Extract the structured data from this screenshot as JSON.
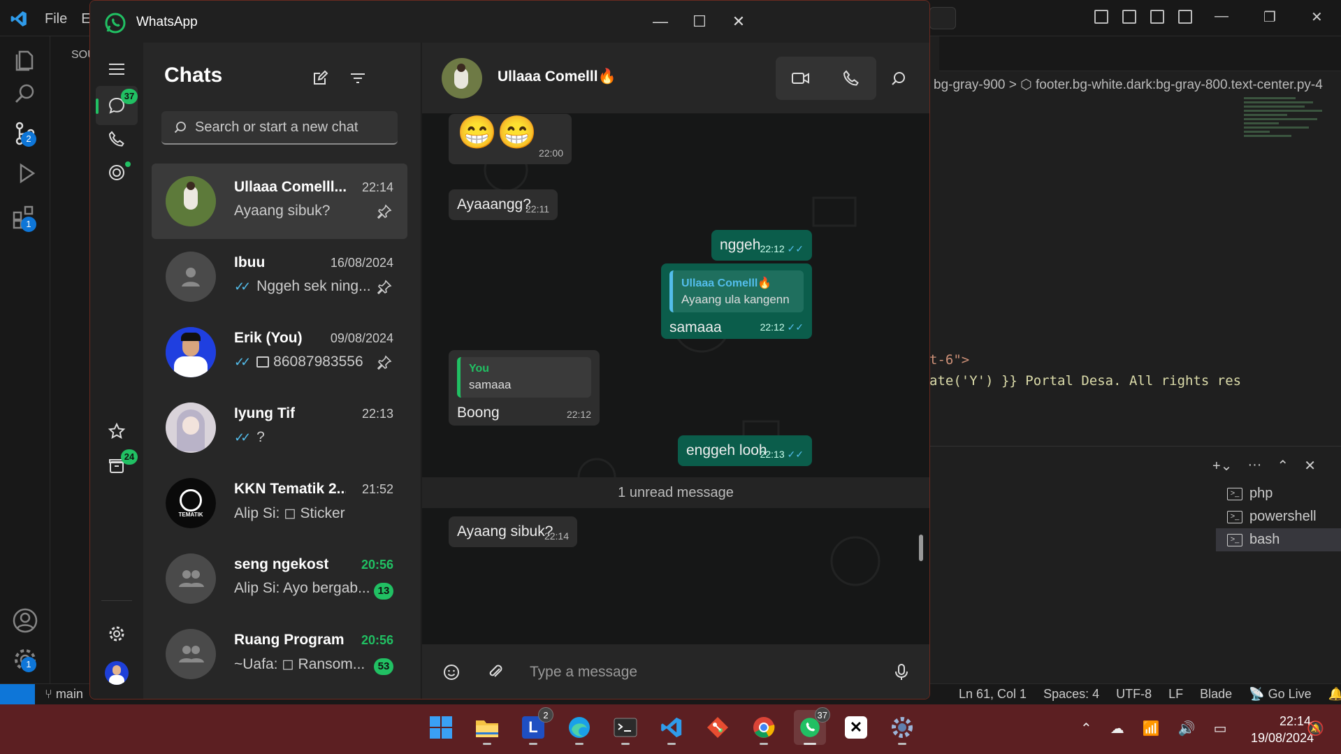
{
  "vscode": {
    "menu": [
      "File",
      "E"
    ],
    "explorer_header": "SOU",
    "breadcrumb": "bg-gray-900 > ⬡ footer.bg-white.dark:bg-gray-800.text-center.py-4",
    "code_line_1": "t-6\">",
    "code_line_2": "ate('Y') }} Portal Desa. All rights res",
    "terminals": [
      "php",
      "powershell",
      "bash"
    ],
    "active_terminal": "bash",
    "activity_badges": {
      "source_control": "2",
      "extensions": "1",
      "settings": "1"
    },
    "status": {
      "branch": "main",
      "position": "Ln 61, Col 1",
      "spaces": "Spaces: 4",
      "encoding": "UTF-8",
      "eol": "LF",
      "language": "Blade",
      "golive": "Go Live"
    }
  },
  "whatsapp": {
    "window_title": "WhatsApp",
    "nav": {
      "chats_badge": "37",
      "archive_badge": "24"
    },
    "chatlist": {
      "title": "Chats",
      "search_placeholder": "Search or start a new chat",
      "items": [
        {
          "name": "Ullaaa Comelll...",
          "time": "22:14",
          "preview": "Ayaang sibuk?",
          "pinned": true,
          "active": true,
          "ticks": false,
          "avatar": "photo-green"
        },
        {
          "name": "Ibuu",
          "time": "16/08/2024",
          "preview": "Nggeh sek ning...",
          "pinned": true,
          "ticks": true,
          "avatar": "default"
        },
        {
          "name": "Erik (You)",
          "time": "09/08/2024",
          "preview": "86087983556",
          "pinned": true,
          "ticks": true,
          "photo": true,
          "avatar": "photo-blue"
        },
        {
          "name": "Iyung Tif",
          "time": "22:13",
          "preview": "?",
          "ticks": true,
          "avatar": "photo-anime"
        },
        {
          "name": "KKN Tematik 2...",
          "time": "21:52",
          "preview": "Alip Si: ◻ Sticker",
          "avatar": "kkn-logo"
        },
        {
          "name": "seng ngekost",
          "time": "20:56",
          "preview": "Alip Si: Ayo bergab...",
          "unread": "13",
          "time_green": true,
          "avatar": "group"
        },
        {
          "name": "Ruang Program",
          "time": "20:56",
          "preview": "~Uafa: ◻ Ransom...",
          "unread": "53",
          "time_green": true,
          "avatar": "group"
        }
      ]
    },
    "conversation": {
      "contact_name": "Ullaaa Comelll🔥",
      "messages": [
        {
          "dir": "in",
          "text": "😁😁",
          "time": "22:00",
          "emoji": true
        },
        {
          "dir": "in",
          "text": "Ayaaangg?",
          "time": "22:11"
        },
        {
          "dir": "out",
          "text": "nggeh",
          "time": "22:12"
        },
        {
          "dir": "out",
          "text": "samaaa",
          "time": "22:12",
          "quote_name": "Ullaaa Comelll🔥",
          "quote_text": "Ayaang ula kangenn"
        },
        {
          "dir": "in",
          "text": "Boong",
          "time": "22:12",
          "quote_name": "You",
          "quote_text": "samaaa"
        },
        {
          "dir": "out",
          "text": "enggeh looh",
          "time": "22:13"
        },
        {
          "dir": "in",
          "text": "Ayaang sibuk?",
          "time": "22:14"
        }
      ],
      "unread_divider": "1 unread message",
      "composer_placeholder": "Type a message"
    }
  },
  "taskbar": {
    "apps": [
      "start",
      "file-explorer",
      "lens",
      "edge",
      "terminal",
      "vscode",
      "git",
      "chrome",
      "whatsapp",
      "capcut",
      "settings"
    ],
    "badges": {
      "lens": "2",
      "whatsapp": "37"
    },
    "clock_time": "22:14",
    "clock_date": "19/08/2024"
  },
  "colors": {
    "wa_green": "#21c063",
    "out_bubble": "#0b5d4b",
    "in_bubble": "#2e2e2e",
    "taskbar": "#5c1f22",
    "vscode_blue": "#0e76d8"
  }
}
